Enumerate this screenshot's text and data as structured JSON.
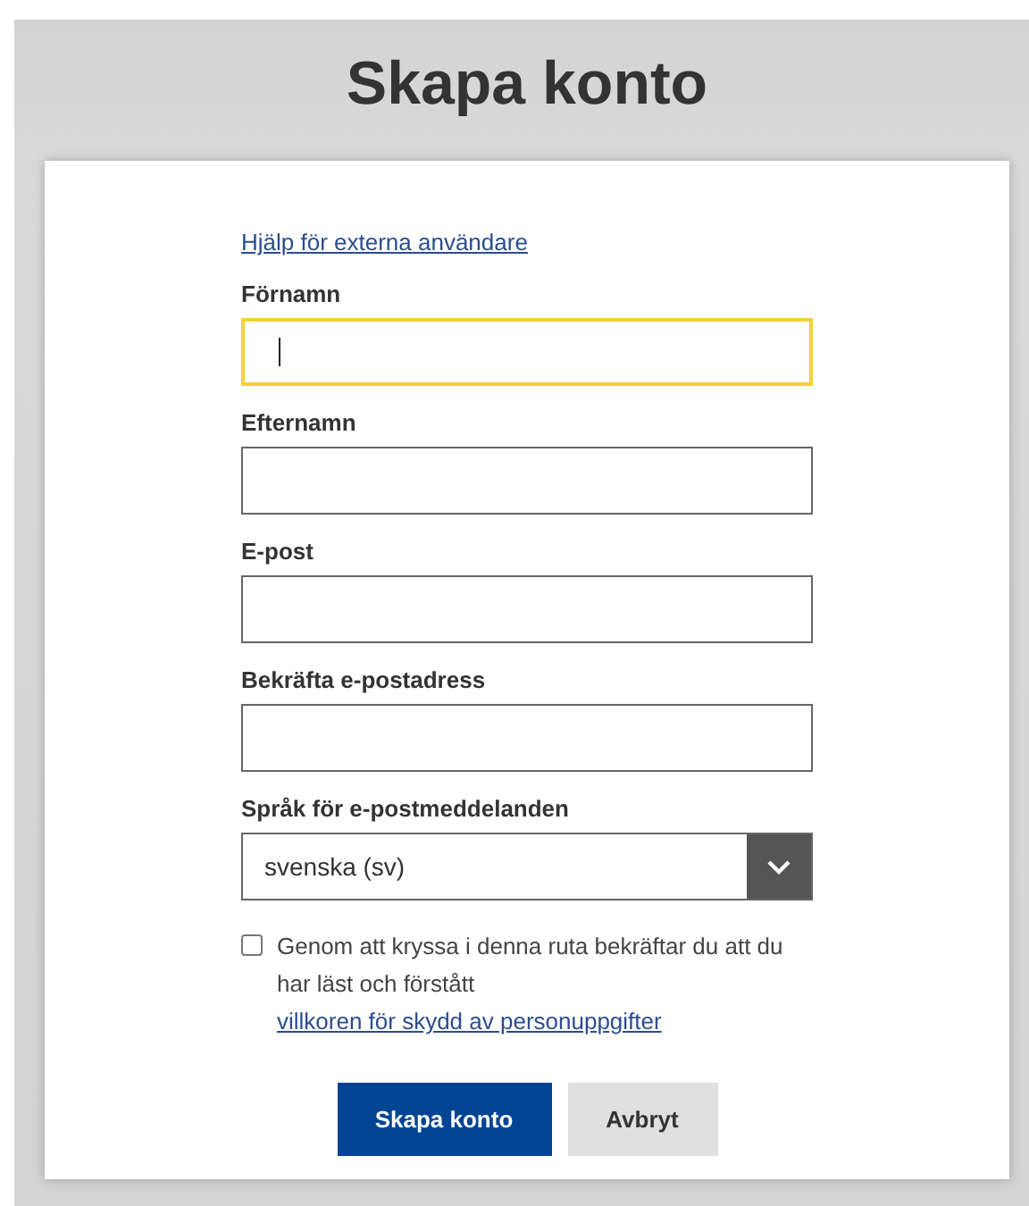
{
  "title": "Skapa konto",
  "help_link": "Hjälp för externa användare",
  "fields": [
    {
      "label": "Förnamn",
      "focused": true
    },
    {
      "label": "Efternamn",
      "focused": false
    },
    {
      "label": "E-post",
      "focused": false
    },
    {
      "label": "Bekräfta e-postadress",
      "focused": false
    }
  ],
  "language": {
    "label": "Språk för e-postmeddelanden",
    "value": "svenska (sv)"
  },
  "consent": {
    "checked": false,
    "text": "Genom att kryssa i denna ruta bekräftar du att du har läst och förstått",
    "link": "villkoren för skydd av personuppgifter"
  },
  "buttons": [
    {
      "label": "Skapa konto",
      "kind": "primary"
    },
    {
      "label": "Avbryt",
      "kind": "secondary"
    }
  ]
}
